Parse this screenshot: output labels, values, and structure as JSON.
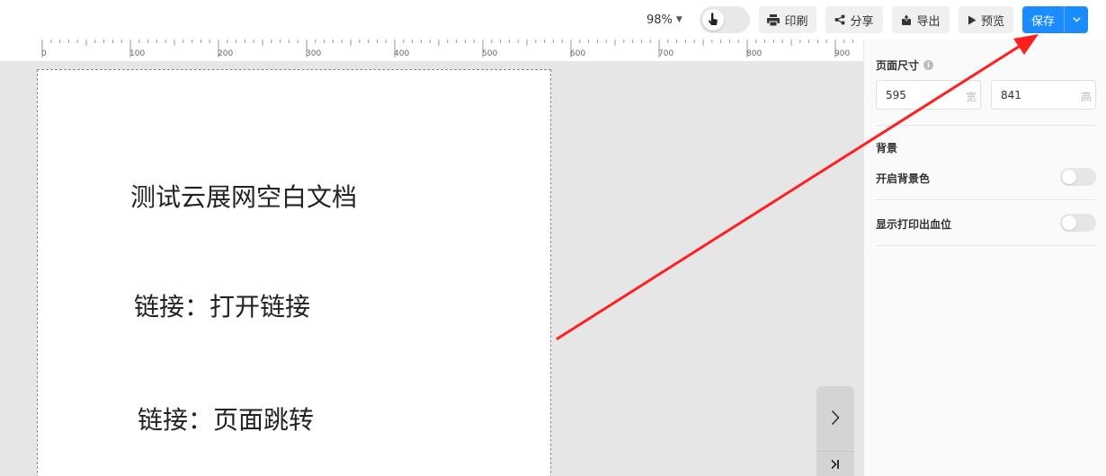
{
  "toolbar": {
    "zoom": "98%",
    "print_label": "印刷",
    "share_label": "分享",
    "export_label": "导出",
    "preview_label": "预览",
    "save_label": "保存"
  },
  "ruler": {
    "labels": [
      "0",
      "100",
      "200",
      "300",
      "400",
      "500",
      "600",
      "700",
      "800",
      "900"
    ]
  },
  "page": {
    "title": "测试云展网空白文档",
    "link1": "链接：打开链接",
    "link2": "链接：页面跳转"
  },
  "panel": {
    "page_size_label": "页面尺寸",
    "width_value": "595",
    "width_unit": "宽",
    "height_value": "841",
    "height_unit": "高",
    "background_label": "背景",
    "enable_bg_color_label": "开启背景色",
    "enable_bg_color_on": false,
    "show_bleed_label": "显示打印出血位",
    "show_bleed_on": false
  },
  "colors": {
    "accent": "#1a8cff",
    "annotation": "#ff1f1f"
  }
}
